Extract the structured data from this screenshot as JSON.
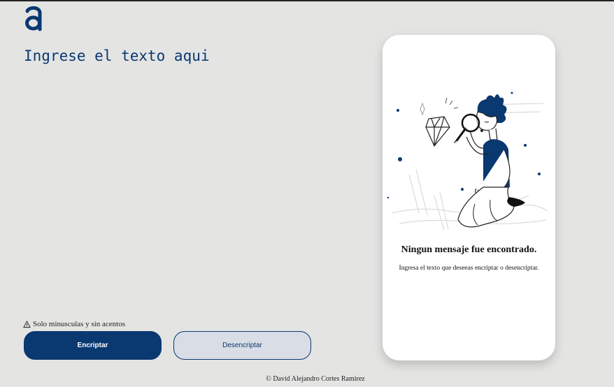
{
  "app": {
    "logo": "logo-a-icon"
  },
  "input": {
    "placeholder": "Ingrese el texto aqui",
    "value": ""
  },
  "hint": {
    "icon": "warning-icon",
    "text": "Solo minusculas y sin acentos"
  },
  "buttons": {
    "encrypt_label": "Encriptar",
    "decrypt_label": "Desencriptar"
  },
  "output_panel": {
    "illustration": "person-with-magnifier-illustration",
    "title": "Ningun mensaje fue encontrado.",
    "subtitle": "Ingresa el texto que deseeas encriptar o desencriptar."
  },
  "footer": {
    "text": "© David Alejandro Cortes Ramirez"
  },
  "colors": {
    "primary": "#0a3871",
    "background": "#e4e4e3",
    "secondary_button": "#d8dde6"
  }
}
